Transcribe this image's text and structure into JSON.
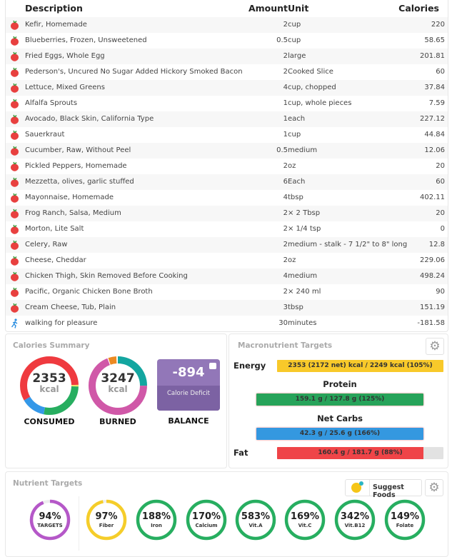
{
  "table": {
    "headers": {
      "description": "Description",
      "amount": "Amount",
      "unit": "Unit",
      "calories": "Calories"
    },
    "rows": [
      {
        "icon": "apple-icon",
        "description": "Kefir, Homemade",
        "amount": "2",
        "unit": "cup",
        "calories": "220"
      },
      {
        "icon": "apple-icon",
        "description": "Blueberries, Frozen, Unsweetened",
        "amount": "0.5",
        "unit": "cup",
        "calories": "58.65"
      },
      {
        "icon": "apple-icon",
        "description": "Fried Eggs, Whole Egg",
        "amount": "2",
        "unit": "large",
        "calories": "201.81"
      },
      {
        "icon": "apple-icon",
        "description": "Pederson's, Uncured No Sugar Added Hickory Smoked Bacon",
        "amount": "2",
        "unit": "Cooked Slice",
        "calories": "60"
      },
      {
        "icon": "apple-icon",
        "description": "Lettuce, Mixed Greens",
        "amount": "4",
        "unit": "cup, chopped",
        "calories": "37.84"
      },
      {
        "icon": "apple-icon",
        "description": "Alfalfa Sprouts",
        "amount": "1",
        "unit": "cup, whole pieces",
        "calories": "7.59"
      },
      {
        "icon": "apple-icon",
        "description": "Avocado, Black Skin, California Type",
        "amount": "1",
        "unit": "each",
        "calories": "227.12"
      },
      {
        "icon": "apple-icon",
        "description": "Sauerkraut",
        "amount": "1",
        "unit": "cup",
        "calories": "44.84"
      },
      {
        "icon": "apple-icon",
        "description": "Cucumber, Raw, Without Peel",
        "amount": "0.5",
        "unit": "medium",
        "calories": "12.06"
      },
      {
        "icon": "apple-icon",
        "description": "Pickled Peppers, Homemade",
        "amount": "2",
        "unit": "oz",
        "calories": "20"
      },
      {
        "icon": "apple-icon",
        "description": "Mezzetta, olives, garlic stuffed",
        "amount": "6",
        "unit": "Each",
        "calories": "60"
      },
      {
        "icon": "apple-icon",
        "description": "Mayonnaise, Homemade",
        "amount": "4",
        "unit": "tbsp",
        "calories": "402.11"
      },
      {
        "icon": "apple-icon",
        "description": "Frog Ranch, Salsa, Medium",
        "amount": "2",
        "unit": "× 2 Tbsp",
        "calories": "20"
      },
      {
        "icon": "apple-icon",
        "description": "Morton, Lite Salt",
        "amount": "2",
        "unit": "× 1/4 tsp",
        "calories": "0"
      },
      {
        "icon": "apple-icon",
        "description": "Celery, Raw",
        "amount": "2",
        "unit": "medium - stalk - 7 1/2\" to 8\" long",
        "calories": "12.8"
      },
      {
        "icon": "apple-icon",
        "description": "Cheese, Cheddar",
        "amount": "2",
        "unit": "oz",
        "calories": "229.06"
      },
      {
        "icon": "apple-icon",
        "description": "Chicken Thigh, Skin Removed Before Cooking",
        "amount": "4",
        "unit": "medium",
        "calories": "498.24"
      },
      {
        "icon": "apple-icon",
        "description": "Pacific, Organic Chicken Bone Broth",
        "amount": "2",
        "unit": "× 240 ml",
        "calories": "90"
      },
      {
        "icon": "apple-icon",
        "description": "Cream Cheese, Tub, Plain",
        "amount": "3",
        "unit": "tbsp",
        "calories": "151.19"
      },
      {
        "icon": "running-person-icon",
        "description": "walking for pleasure",
        "amount": "30",
        "unit": "minutes",
        "calories": "-181.58"
      }
    ]
  },
  "calories_summary": {
    "title": "Calories Summary",
    "consumed": {
      "value": "2353",
      "unit": "kcal",
      "label": "CONSUMED",
      "segments": [
        {
          "color": "#ef3a3f",
          "from": 0,
          "to": 0.245
        },
        {
          "color": "#f4e36a",
          "from": 0.245,
          "to": 0.255
        },
        {
          "color": "#27ae60",
          "from": 0.255,
          "to": 0.53
        },
        {
          "color": "#3498e8",
          "from": 0.53,
          "to": 0.665
        },
        {
          "color": "#ef3a3f",
          "from": 0.665,
          "to": 1
        }
      ]
    },
    "burned": {
      "value": "3247",
      "unit": "kcal",
      "label": "BURNED",
      "segments": [
        {
          "color": "#13a6a0",
          "from": 0,
          "to": 0.25
        },
        {
          "color": "#d058a8",
          "from": 0.25,
          "to": 0.94
        },
        {
          "color": "#ec8a22",
          "from": 0.945,
          "to": 0.99
        }
      ]
    },
    "balance": {
      "value": "-894",
      "caption": "Calorie Deficit",
      "label": "BALANCE"
    }
  },
  "macros": {
    "title": "Macronutrient Targets",
    "energy": {
      "label": "Energy",
      "text": "2353 (2172 net) kcal / 2249 kcal (105%)",
      "percent": 105,
      "color": "#f8c92a"
    },
    "protein": {
      "label": "Protein",
      "text": "159.1 g / 127.8 g (125%)",
      "percent": 125,
      "color": "#27a35a"
    },
    "net_carbs": {
      "label": "Net Carbs",
      "text": "42.3 g / 25.6 g (166%)",
      "percent": 166,
      "color": "#3498e0"
    },
    "fat": {
      "label": "Fat",
      "text": "160.4 g / 181.7 g (88%)",
      "percent": 88,
      "color": "#ef4448"
    }
  },
  "nutrients": {
    "title": "Nutrient Targets",
    "suggest_label": "Suggest Foods",
    "items": [
      {
        "percent_text": "94%",
        "name": "TARGETS",
        "percent": 94,
        "color": "#b558c8"
      },
      {
        "percent_text": "97%",
        "name": "Fiber",
        "percent": 97,
        "color": "#f5cd2a"
      },
      {
        "percent_text": "188%",
        "name": "Iron",
        "percent": 188,
        "color": "#27ae60"
      },
      {
        "percent_text": "170%",
        "name": "Calcium",
        "percent": 170,
        "color": "#27ae60"
      },
      {
        "percent_text": "583%",
        "name": "Vit.A",
        "percent": 583,
        "color": "#27ae60"
      },
      {
        "percent_text": "169%",
        "name": "Vit.C",
        "percent": 169,
        "color": "#27ae60"
      },
      {
        "percent_text": "342%",
        "name": "Vit.B12",
        "percent": 342,
        "color": "#27ae60"
      },
      {
        "percent_text": "149%",
        "name": "Folate",
        "percent": 149,
        "color": "#27ae60"
      }
    ]
  }
}
